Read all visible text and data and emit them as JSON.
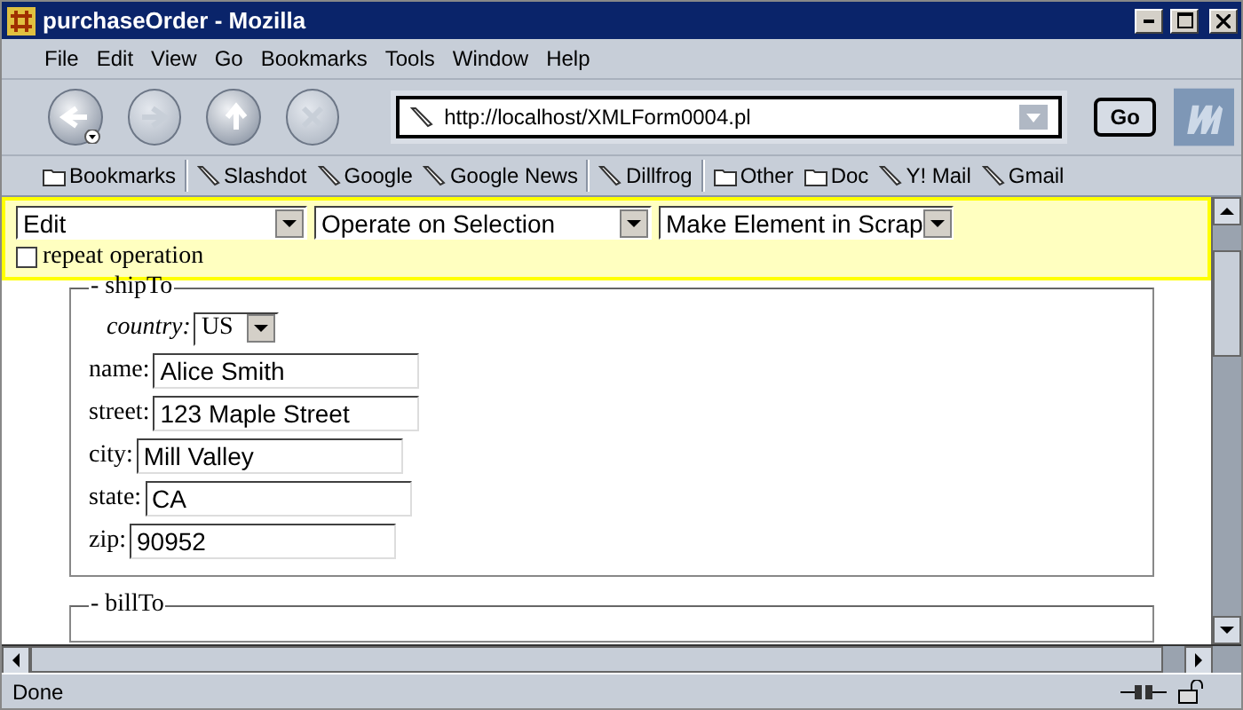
{
  "window": {
    "title": "purchaseOrder - Mozilla"
  },
  "menu": [
    "File",
    "Edit",
    "View",
    "Go",
    "Bookmarks",
    "Tools",
    "Window",
    "Help"
  ],
  "nav_buttons": [
    {
      "kind": "back",
      "disabled": false
    },
    {
      "kind": "forward",
      "disabled": true
    },
    {
      "kind": "reload",
      "disabled": false
    },
    {
      "kind": "stop",
      "disabled": true
    }
  ],
  "address": {
    "value": "http://localhost/XMLForm0004.pl"
  },
  "go_button": "Go",
  "bookmarks": [
    {
      "kind": "folder",
      "label": "Bookmarks"
    },
    {
      "kind": "link",
      "label": "Slashdot"
    },
    {
      "kind": "link",
      "label": "Google"
    },
    {
      "kind": "link",
      "label": "Google News"
    },
    {
      "kind": "link",
      "label": "Dillfrog"
    },
    {
      "kind": "folder",
      "label": "Other"
    },
    {
      "kind": "folder",
      "label": "Doc"
    },
    {
      "kind": "link",
      "label": "Y! Mail"
    },
    {
      "kind": "link",
      "label": "Gmail"
    }
  ],
  "edit_panel": {
    "selects": [
      "Edit",
      "Operate on Selection",
      "Make Element in Scrap"
    ],
    "repeat": {
      "label": "repeat operation",
      "checked": false
    }
  },
  "sections": [
    {
      "legend": "- shipTo",
      "country": {
        "label": "country:",
        "value": "US"
      },
      "fields": [
        {
          "label": "name:",
          "value": "Alice Smith"
        },
        {
          "label": "street:",
          "value": "123 Maple Street"
        },
        {
          "label": "city:",
          "value": "Mill Valley"
        },
        {
          "label": "state:",
          "value": "CA"
        },
        {
          "label": "zip:",
          "value": "90952"
        }
      ]
    },
    {
      "legend": "- billTo"
    }
  ],
  "status_bar": {
    "text": "Done"
  }
}
